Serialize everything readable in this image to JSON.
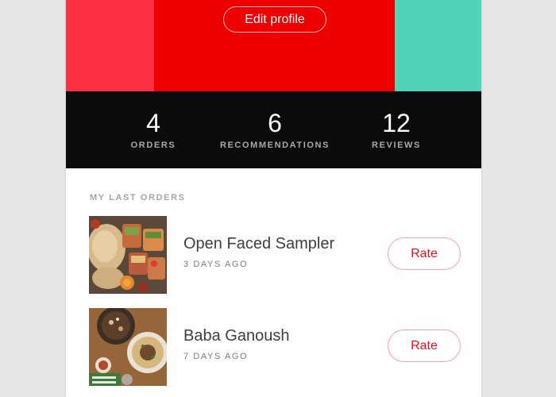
{
  "profile": {
    "edit_button_label": "Edit profile",
    "colors": {
      "left": "#fe2e44",
      "middle": "#ee0000",
      "right": "#51d3b7"
    }
  },
  "stats": {
    "orders": {
      "value": "4",
      "label": "ORDERS"
    },
    "recommendations": {
      "value": "6",
      "label": "RECOMMENDATIONS"
    },
    "reviews": {
      "value": "12",
      "label": "REVIEWS"
    }
  },
  "orders_section": {
    "title": "MY LAST ORDERS",
    "items": [
      {
        "name": "Open Faced Sampler",
        "time": "3 DAYS AGO",
        "rate_label": "Rate",
        "image": "food-sampler-photo"
      },
      {
        "name": "Baba Ganoush",
        "time": "7 DAYS AGO",
        "rate_label": "Rate",
        "image": "baba-ganoush-photo"
      }
    ]
  }
}
